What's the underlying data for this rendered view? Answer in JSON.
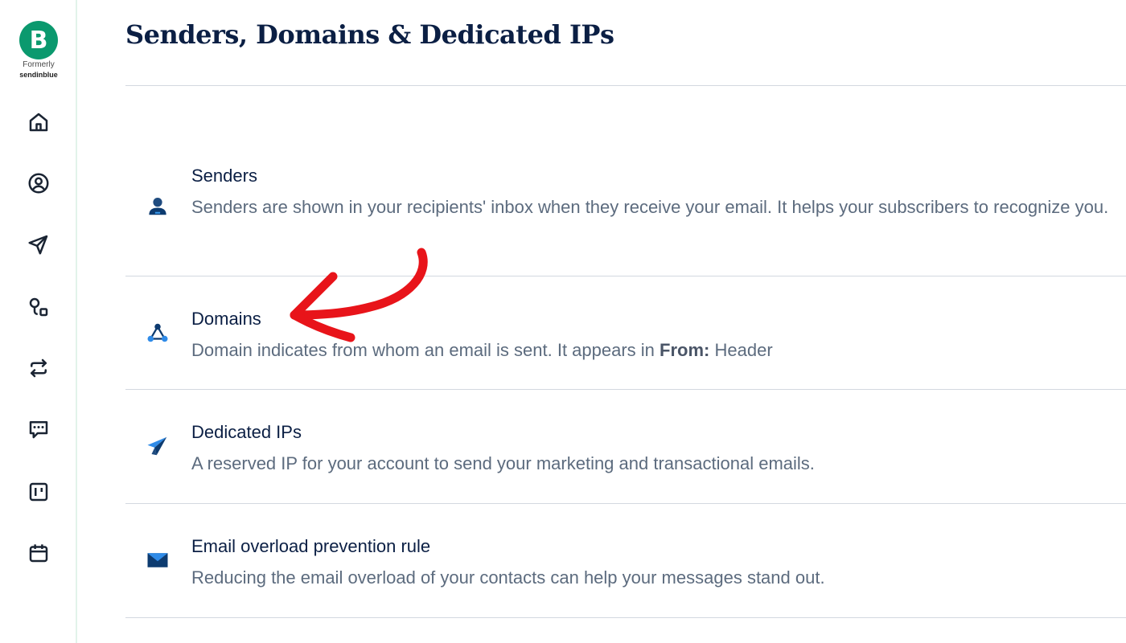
{
  "brand": {
    "logo_letter": "B",
    "formerly_label": "Formerly",
    "former_name": "sendinblue",
    "accent_color": "#0b996e"
  },
  "sidebar": {
    "items": [
      {
        "name": "home-icon"
      },
      {
        "name": "contacts-icon"
      },
      {
        "name": "campaigns-icon"
      },
      {
        "name": "automations-icon"
      },
      {
        "name": "transactional-icon"
      },
      {
        "name": "conversations-icon"
      },
      {
        "name": "sales-icon"
      },
      {
        "name": "meetings-icon"
      }
    ]
  },
  "page": {
    "title": "Senders, Domains & Dedicated IPs"
  },
  "settings": [
    {
      "title": "Senders",
      "description": "Senders are shown in your recipients' inbox when they receive your email. It helps your subscribers to recognize you.",
      "icon": "sender-person-icon"
    },
    {
      "title": "Domains",
      "description_before": "Domain indicates from whom an email is sent. It appears in",
      "description_bold": "From:",
      "description_after": "Header",
      "icon": "domain-nodes-icon"
    },
    {
      "title": "Dedicated IPs",
      "description": "A reserved IP for your account to send your marketing and transactional emails.",
      "icon": "paper-plane-icon"
    },
    {
      "title": "Email overload prevention rule",
      "description": "Reducing the email overload of your contacts can help your messages stand out.",
      "icon": "envelope-icon"
    }
  ],
  "annotation": {
    "type": "red-arrow",
    "target": "Domains",
    "color": "#e8141a"
  }
}
